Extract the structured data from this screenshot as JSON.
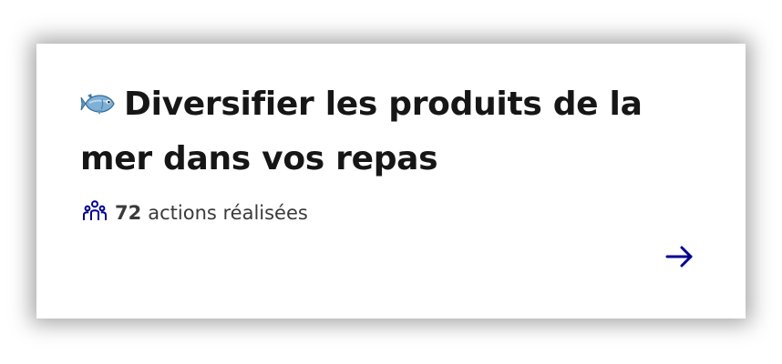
{
  "card": {
    "title": "Diversifier les produits de la mer dans vos repas",
    "title_icon": "fish-emoji",
    "actions_count": "72",
    "actions_label": "actions réalisées",
    "people_icon": "people-group-icon",
    "arrow_icon": "arrow-right-icon",
    "colors": {
      "accent": "#000091",
      "title": "#161616",
      "meta_text": "#3a3a3a",
      "fish_body": "#7fb0d6"
    }
  }
}
